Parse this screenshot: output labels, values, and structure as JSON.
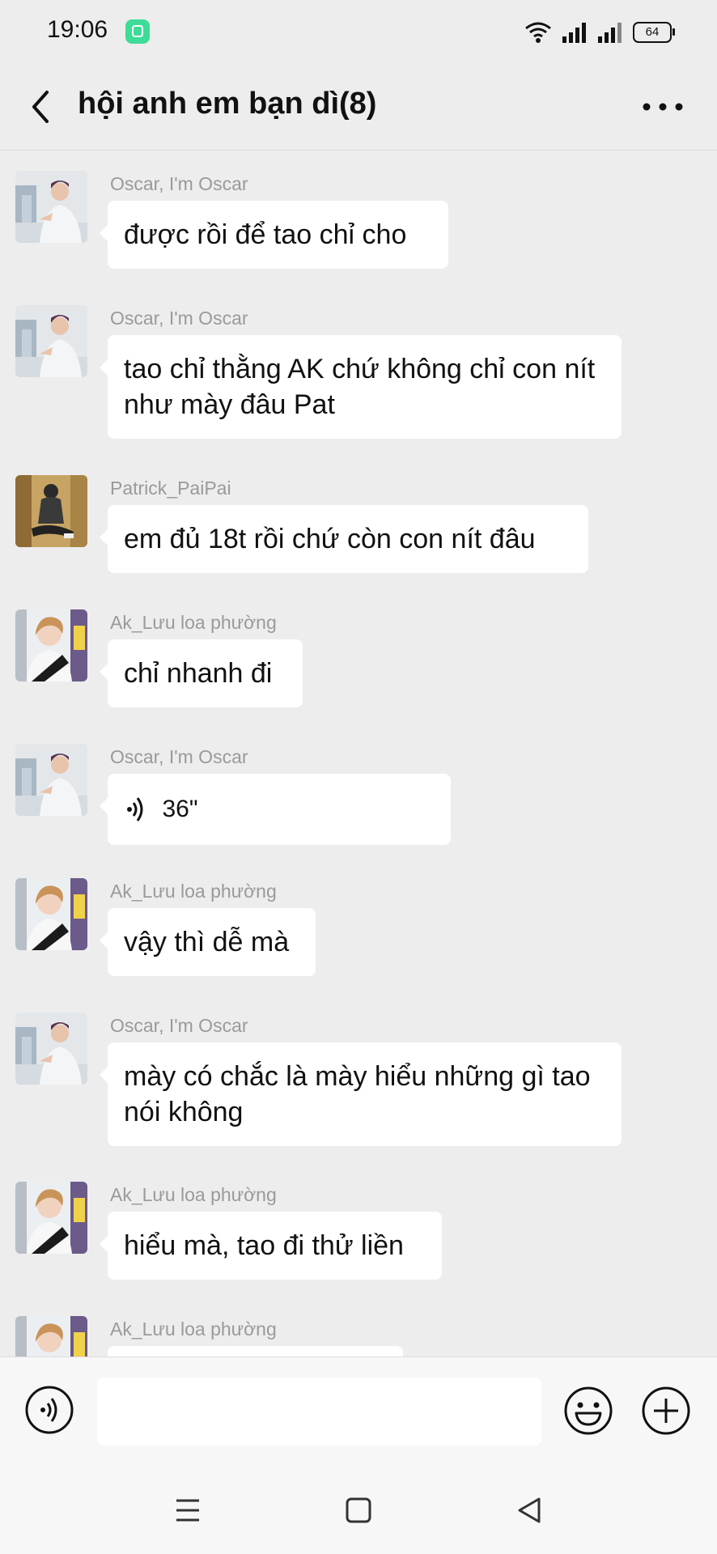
{
  "status_bar": {
    "time": "19:06",
    "battery": "64"
  },
  "header": {
    "title": "hội anh em bạn dì(8)"
  },
  "messages": [
    {
      "sender": "Oscar, I'm Oscar",
      "text": "được rồi để tao chỉ cho",
      "avatar": "oscar"
    },
    {
      "sender": "Oscar, I'm Oscar",
      "text": "tao chỉ thằng AK chứ không chỉ con nít như mày đâu Pat",
      "avatar": "oscar"
    },
    {
      "sender": "Patrick_PaiPai",
      "text": "em đủ 18t rồi chứ còn con nít đâu",
      "avatar": "patrick"
    },
    {
      "sender": "Ak_Lưu loa phường",
      "text": "chỉ nhanh đi",
      "avatar": "ak"
    },
    {
      "sender": "Oscar, I'm Oscar",
      "voice_duration": "36\"",
      "avatar": "oscar"
    },
    {
      "sender": "Ak_Lưu loa phường",
      "text": "vậy thì dễ mà",
      "avatar": "ak"
    },
    {
      "sender": "Oscar, I'm Oscar",
      "text": "mày có chắc là mày hiểu những gì tao nói không",
      "avatar": "oscar"
    },
    {
      "sender": "Ak_Lưu loa phường",
      "text": "hiểu mà, tao đi thử liền",
      "avatar": "ak"
    },
    {
      "sender": "Ak_Lưu loa phường",
      "text": "",
      "avatar": "ak"
    }
  ],
  "input_bar": {
    "value": "",
    "placeholder": ""
  },
  "icons": {
    "back": "chevron-left-icon",
    "more": "more-dots-icon",
    "voice": "voice-icon",
    "emoji": "smiley-icon",
    "plus": "plus-icon",
    "menu": "menu-icon",
    "home": "home-square-icon",
    "nav_back": "back-triangle-icon"
  },
  "colors": {
    "background": "#ededed",
    "bubble": "#ffffff",
    "sender": "#9a9a9a",
    "text": "#111111"
  }
}
